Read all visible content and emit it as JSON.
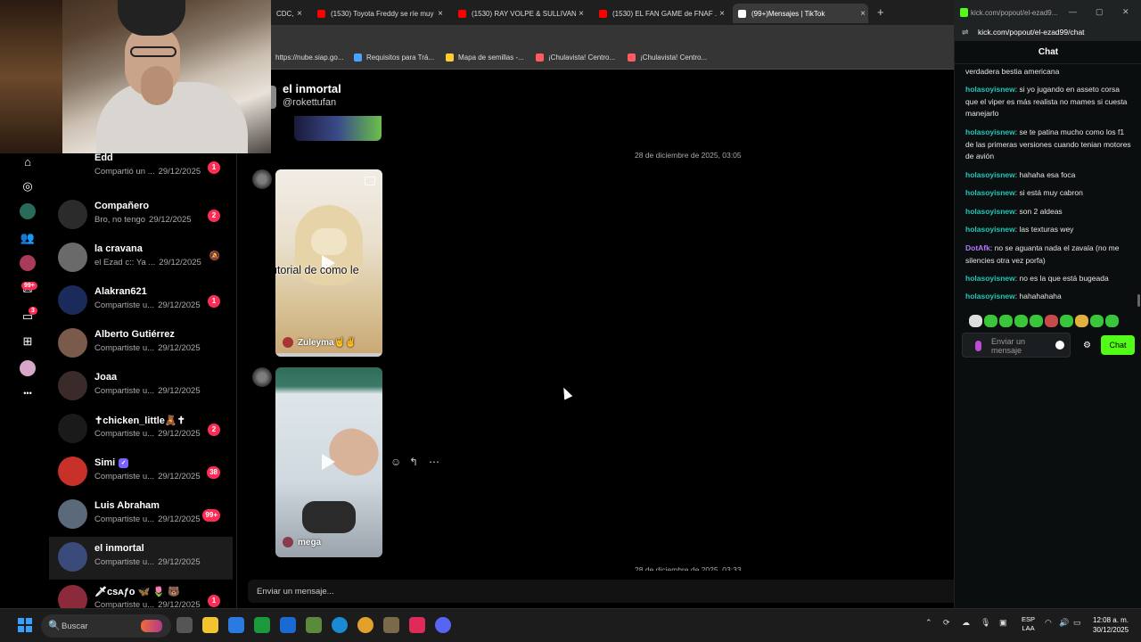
{
  "browser": {
    "tabs": [
      {
        "label": "CDC, B",
        "icon_color": "#888888"
      },
      {
        "label": "(1530) Toyota Freddy se ríe muy",
        "icon_color": "#ff0000"
      },
      {
        "label": "(1530) RAY VOLPE & SULLIVAN",
        "icon_color": "#ff0000"
      },
      {
        "label": "(1530) EL FAN GAME de FNAF ...",
        "icon_color": "#ff0000"
      },
      {
        "label": "(99+)Mensajes | TikTok",
        "icon_color": "#ffffff"
      }
    ],
    "close_glyph": "×",
    "new_tab_glyph": "+",
    "bookmarks": [
      {
        "label": "https://nube.siap.go...",
        "icon_color": "#555555"
      },
      {
        "label": "Requisitos para Trá...",
        "icon_color": "#4aa3ff"
      },
      {
        "label": "Mapa de semillas -...",
        "icon_color": "#ffcc33"
      },
      {
        "label": "¡Chulavista! Centro...",
        "icon_color": "#ff5a5f"
      },
      {
        "label": "¡Chulavista! Centro...",
        "icon_color": "#ff5a5f"
      }
    ]
  },
  "nav": {
    "icons": [
      "home-icon",
      "explore-icon",
      "following-icon",
      "friends-icon",
      "live-icon",
      "activity-icon",
      "messages-icon",
      "upload-icon",
      "profile-icon",
      "more-icon"
    ],
    "activity_badge": "99+",
    "messages_badge": "3",
    "more_glyph": "•••"
  },
  "chats": [
    {
      "name": "Edd",
      "preview": "Compartió un ...",
      "date": "29/12/2025",
      "badge": "1",
      "avatar_color": "#555"
    },
    {
      "name": "Compañero",
      "preview": "Bro, no tengo",
      "date": "29/12/2025",
      "badge": "2",
      "avatar_color": "#2b2b2b"
    },
    {
      "name": "la cravana",
      "preview": "el Ezad c:: Ya ...",
      "date": "29/12/2025",
      "muted": true,
      "avatar_color": "#6a6a6a"
    },
    {
      "name": "Alakran621",
      "preview": "Compartiste u...",
      "date": "29/12/2025",
      "badge": "1",
      "avatar_color": "#1a2a5a"
    },
    {
      "name": "Alberto Gutiérrez",
      "preview": "Compartiste u...",
      "date": "29/12/2025",
      "avatar_color": "#7a5a4a"
    },
    {
      "name": "Joaa",
      "preview": "Compartiste u...",
      "date": "29/12/2025",
      "avatar_color": "#3a2a2a"
    },
    {
      "name": "✝chicken_little🧸✝",
      "preview": "Compartiste u...",
      "date": "29/12/2025",
      "badge": "2",
      "avatar_color": "#1a1a1a"
    },
    {
      "name": "Simi",
      "verified": true,
      "preview": "Compartiste u...",
      "date": "29/12/2025",
      "badge": "38",
      "avatar_color": "#c8302a"
    },
    {
      "name": "Luis Abraham",
      "preview": "Compartiste u...",
      "date": "29/12/2025",
      "badge": "99+",
      "avatar_color": "#5a6a7a"
    },
    {
      "name": "el inmortal",
      "preview": "Compartiste u...",
      "date": "29/12/2025",
      "selected": true,
      "avatar_color": "#3a4a7a"
    },
    {
      "name": "🗡ᴄѕᴀƒᴏ 🦋 🌷 🐻",
      "preview": "Compartiste u...",
      "date": "29/12/2025",
      "badge": "1",
      "avatar_color": "#8a2a3a"
    }
  ],
  "mute_glyph": "🔕",
  "conversation": {
    "title": "el inmortal",
    "handle": "@rokettufan",
    "date_sep_1": "28 de diciembre de 2025, 03:05",
    "date_sep_2": "28 de diciembre de 2025, 03:33",
    "video_1": {
      "caption": "utorial de como le",
      "author": "Zuleyma🤘✌"
    },
    "video_2": {
      "author": "mega"
    },
    "hover_icons": [
      "react-icon",
      "reply-icon",
      "more-options-icon"
    ],
    "hover_glyphs": [
      "☺",
      "↰",
      "⋯"
    ],
    "compose_placeholder": "Enviar un mensaje...",
    "compose_icons": [
      "image-icon",
      "emoji-icon"
    ],
    "compose_glyphs": [
      "▣",
      "☺"
    ]
  },
  "kick": {
    "popup_url": "kick.com/popout/el-ezad9...",
    "address": "kick.com/popout/el-ezad99/chat",
    "header": "Chat",
    "window_glyphs": [
      "—",
      "▢",
      "✕"
    ],
    "address_icon_glyph": "⇌",
    "messages": [
      {
        "user": "",
        "text": "verdadera bestia americana"
      },
      {
        "user": "holasoyisnew",
        "text": "si yo jugando en asseto corsa que el viper es más realista no mames si cuesta manejarlo"
      },
      {
        "user": "holasoyisnew",
        "text": "se te patina mucho como los f1 de las primeras versiones cuando tenian motores de avión"
      },
      {
        "user": "holasoyisnew",
        "text": "hahaha esa foca"
      },
      {
        "user": "holasoyisnew",
        "text": "si está muy cabron"
      },
      {
        "user": "holasoyisnew",
        "text": "son 2 aldeas"
      },
      {
        "user": "holasoyisnew",
        "text": "las texturas wey"
      },
      {
        "user": "DotAfk",
        "text": "no se aguanta nada el zavala (no me silencies otra vez porfa)",
        "purple": true
      },
      {
        "user": "holasoyisnew",
        "text": "no es la que está bugeada"
      },
      {
        "user": "holasoyisnew",
        "text": "hahahahaha"
      }
    ],
    "input_placeholder": "Enviar un mensaje",
    "gear_glyph": "⚙",
    "send_label": "Chat",
    "accent": "#53fc18"
  },
  "taskbar": {
    "search_placeholder": "Buscar",
    "search_glyph": "🔍",
    "chevron_glyph": "⌃",
    "language": "ESP",
    "layout": "LAA",
    "time": "12:08 a. m.",
    "date": "30/12/2025"
  }
}
